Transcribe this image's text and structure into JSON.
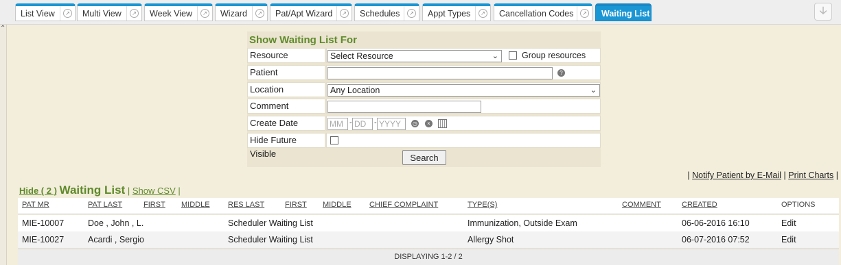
{
  "tabs": [
    {
      "label": "List View"
    },
    {
      "label": "Multi View"
    },
    {
      "label": "Week View"
    },
    {
      "label": "Wizard"
    },
    {
      "label": "Pat/Apt Wizard"
    },
    {
      "label": "Schedules"
    },
    {
      "label": "Appt Types"
    },
    {
      "label": "Cancellation Codes"
    },
    {
      "label": "Waiting List"
    }
  ],
  "active_tab": "Waiting List",
  "panel": {
    "title": "Show Waiting List For",
    "resource_label": "Resource",
    "resource_value": "Select Resource",
    "group_label": "Group resources",
    "patient_label": "Patient",
    "location_label": "Location",
    "location_value": "Any Location",
    "comment_label": "Comment",
    "create_date_label": "Create Date",
    "date_mm": "MM",
    "date_dd": "DD",
    "date_yyyy": "YYYY",
    "hide_future_label": "Hide Future Visible",
    "search_label": "Search"
  },
  "links": {
    "notify": "Notify Patient by E-Mail",
    "print": "Print Charts"
  },
  "waiting_list": {
    "hide_label": "Hide ( 2 )",
    "title": "Waiting List",
    "csv_label": "Show CSV",
    "columns": [
      "PAT MR",
      "PAT LAST",
      "FIRST",
      "MIDDLE",
      "RES LAST",
      "FIRST",
      "MIDDLE",
      "CHIEF COMPLAINT",
      "TYPE(S)",
      "COMMENT",
      "CREATED",
      "OPTIONS"
    ],
    "rows": [
      {
        "mr": "MIE-10007",
        "pat": "Doe , John , L.",
        "res": "Scheduler Waiting List",
        "types": "Immunization, Outside Exam",
        "created": "06-06-2016 16:10",
        "option": "Edit"
      },
      {
        "mr": "MIE-10027",
        "pat": "Acardi , Sergio",
        "res": "Scheduler Waiting List",
        "types": "Allergy Shot",
        "created": "06-07-2016 07:52",
        "option": "Edit"
      }
    ],
    "footer": "DISPLAYING 1-2 / 2"
  },
  "colors": {
    "accent": "#1a96d4",
    "title_green": "#5f8a2a",
    "background": "#f3eedc"
  }
}
